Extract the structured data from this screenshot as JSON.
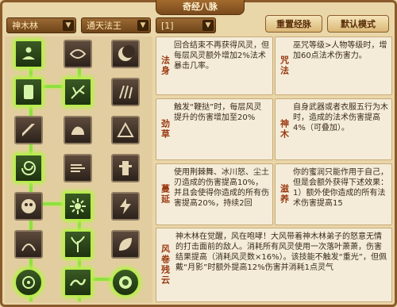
{
  "window": {
    "title": "奇经八脉"
  },
  "dropdowns": [
    {
      "label": "神木林"
    },
    {
      "label": "通天法王"
    },
    {
      "label": "[1]"
    }
  ],
  "buttons": {
    "reset": "重置经脉",
    "default": "默认模式"
  },
  "skills": [
    {
      "name": "法身",
      "desc": "回合结束不再获得风灵，但每层风灵额外增加2%法术暴击几率。"
    },
    {
      "name": "咒法",
      "desc": "巫咒等级>人物等级时，增加60点法术伤害力。"
    },
    {
      "name": "劲草",
      "desc": "触发“鞭挞”时，每层风灵提升的伤害增加至20%"
    },
    {
      "name": "神木",
      "desc": "自身武器或者衣服五行为木时，造成的法术伤害提高4%（可叠加）。"
    },
    {
      "name": "蔓延",
      "desc": "使用荆棘舞、冰川怒、尘土刃造成的伤害提高10%，并且会使得你造成的所有伤害提高20%，持续2回"
    },
    {
      "name": "滋养",
      "desc": "你的蜜润只能作用于自己，但是会额外获得下述效果：1）额外使你造成的所有法术伤害提高15"
    },
    {
      "name": "风卷残云",
      "desc": "神木林在觉醒，风在咆哮！大风带着神木林弟子的怒意无情的打击面前的敌人。消耗所有风灵使用一次落叶萧萧，伤害结果提高（消耗风灵数×16%）。该技能不触发“重光”，但佩戴“月影”时额外提高12%伤害并消耗1点灵气"
    }
  ],
  "colors": {
    "active_glow": "#b9f24a",
    "skill_name": "#9a3a12",
    "frame": "#8a5a2a"
  }
}
